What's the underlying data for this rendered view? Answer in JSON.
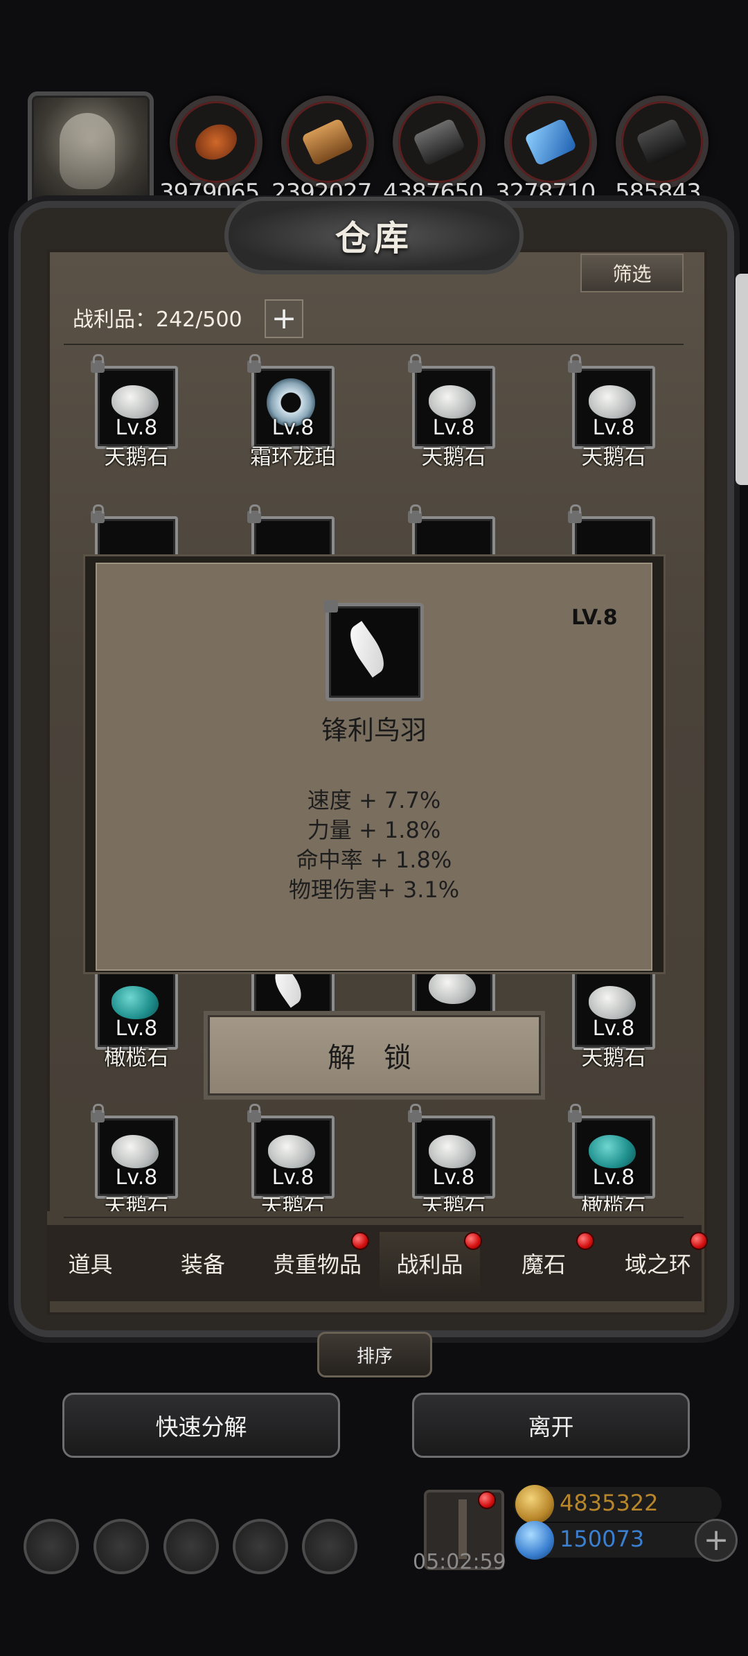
{
  "resources": {
    "values": [
      "3979065",
      "2392027",
      "4387650",
      "3278710",
      "585843"
    ],
    "icons": [
      "ore-icon",
      "wood-icon",
      "iron-icon",
      "crystal-icon",
      "stone-icon"
    ]
  },
  "warehouse": {
    "title": "仓库",
    "filter_label": "筛选",
    "loot_label": "战利品：242/500",
    "plus_label": "+"
  },
  "grid": {
    "row1": [
      {
        "level": "Lv.8",
        "name": "天鹅石"
      },
      {
        "level": "Lv.8",
        "name": "霜环龙珀"
      },
      {
        "level": "Lv.8",
        "name": "天鹅石"
      },
      {
        "level": "Lv.8",
        "name": "天鹅石"
      }
    ],
    "row4": [
      {
        "level": "Lv.8",
        "name": "橄榄石"
      },
      {
        "level": "Lv.8",
        "name": "天鹅石"
      }
    ],
    "row5": [
      {
        "level": "Lv.8",
        "name": "天鹅石"
      },
      {
        "level": "Lv.8",
        "name": "天鹅石"
      },
      {
        "level": "Lv.8",
        "name": "天鹅石"
      },
      {
        "level": "Lv.8",
        "name": "橄榄石"
      }
    ]
  },
  "popup": {
    "level": "LV.8",
    "name": "锋利鸟羽",
    "stats": [
      "速度 + 7.7%",
      "力量 + 1.8%",
      "命中率 + 1.8%",
      "物理伤害+ 3.1%"
    ],
    "unlock_label": "解 锁"
  },
  "tabs": [
    "道具",
    "装备",
    "贵重物品",
    "战利品",
    "魔石",
    "域之环"
  ],
  "active_tab": "战利品",
  "sort_label": "排序",
  "quick_decompose_label": "快速分解",
  "leave_label": "离开",
  "hud": {
    "timer": "05:02:59",
    "gold": "4835322",
    "gems": "150073",
    "colors": {
      "gold": "#b8862a",
      "gem": "#3a7fd0"
    }
  }
}
